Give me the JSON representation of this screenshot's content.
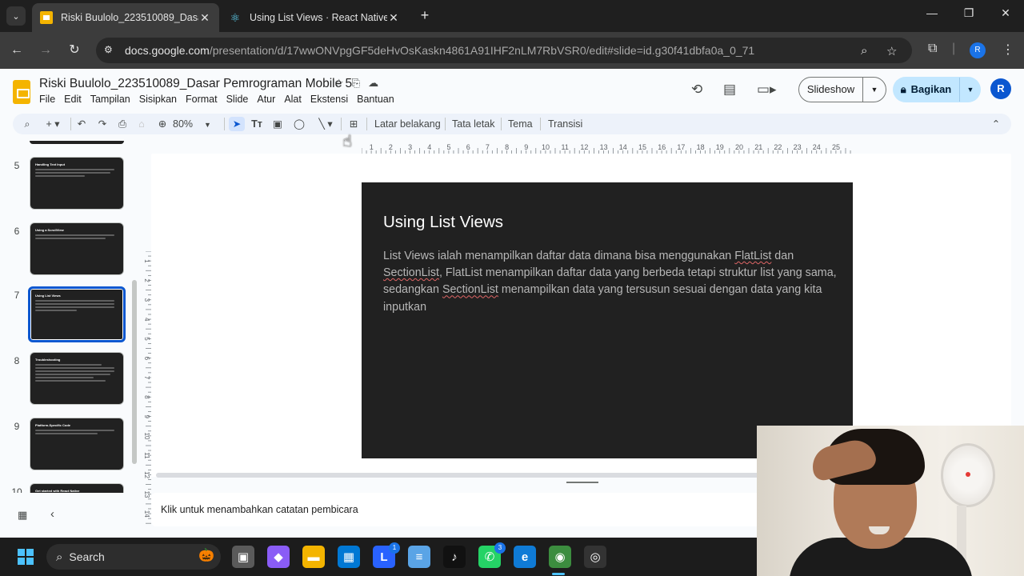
{
  "browser": {
    "tabs": [
      {
        "title": "Riski Buulolo_223510089_Dasar Pemrograman Mobile 5",
        "active": true
      },
      {
        "title": "Using List Views · React Native",
        "active": false
      }
    ],
    "url_host": "docs.google.com",
    "url_path": "/presentation/d/17wwONVpgGF5deHvOsKaskn4861A91IHF2nLM7RbVSR0/edit#slide=id.g30f41dbfa0a_0_71",
    "profile_initial": "R"
  },
  "app": {
    "doc_title": "Riski Buulolo_223510089_Dasar Pemrograman Mobile 5",
    "menu": [
      "File",
      "Edit",
      "Tampilan",
      "Sisipkan",
      "Format",
      "Slide",
      "Atur",
      "Alat",
      "Ekstensi",
      "Bantuan"
    ],
    "slideshow_label": "Slideshow",
    "share_label": "Bagikan",
    "account_initial": "R",
    "toolbar": {
      "zoom": "80%",
      "background_label": "Latar belakang",
      "layout_label": "Tata letak",
      "theme_label": "Tema",
      "transition_label": "Transisi"
    },
    "filmstrip": [
      {
        "num": "5",
        "title": "Handling Text Input",
        "selected": false
      },
      {
        "num": "6",
        "title": "Using a ScrollView",
        "selected": false
      },
      {
        "num": "7",
        "title": "Using List Views",
        "selected": true
      },
      {
        "num": "8",
        "title": "Troubleshooting",
        "selected": false
      },
      {
        "num": "9",
        "title": "Platform-Specific Code",
        "selected": false
      },
      {
        "num": "10",
        "title": "Get started with React Native",
        "selected": false
      }
    ],
    "ruler_h": [
      "1",
      "2",
      "3",
      "4",
      "5",
      "6",
      "7",
      "8",
      "9",
      "10",
      "11",
      "12",
      "13",
      "14",
      "15",
      "16",
      "17",
      "18",
      "19",
      "20",
      "21",
      "22",
      "23",
      "24",
      "25"
    ],
    "ruler_v": [
      "1",
      "2",
      "3",
      "4",
      "5",
      "6",
      "7",
      "8",
      "9",
      "10",
      "11",
      "12",
      "13",
      "14"
    ],
    "slide": {
      "title": "Using List Views",
      "body_parts": [
        {
          "text": "List Views ialah menampilkan daftar data dimana bisa menggunakan ",
          "spell": false
        },
        {
          "text": "FlatList",
          "spell": true
        },
        {
          "text": " dan ",
          "spell": false
        },
        {
          "text": "SectionList",
          "spell": true
        },
        {
          "text": ", FlatList menampilkan daftar data yang berbeda tetapi struktur list yang sama, sedangkan ",
          "spell": false
        },
        {
          "text": "SectionList",
          "spell": true
        },
        {
          "text": " menampilkan data yang tersusun sesuai dengan data yang kita inputkan",
          "spell": false
        }
      ]
    },
    "notes_placeholder": "Klik untuk menambahkan catatan pembicara"
  },
  "taskbar": {
    "search_label": "Search",
    "apps": [
      {
        "name": "file-manager",
        "glyph": "▣",
        "color": "#5a5a5a",
        "badge": ""
      },
      {
        "name": "copilot",
        "glyph": "◆",
        "color": "#8a5cf6",
        "badge": ""
      },
      {
        "name": "file-explorer",
        "glyph": "▬",
        "color": "#f4b400",
        "badge": ""
      },
      {
        "name": "microsoft-store",
        "glyph": "▦",
        "color": "#0078d4",
        "badge": ""
      },
      {
        "name": "lark",
        "glyph": "L",
        "color": "#2962ff",
        "badge": "1"
      },
      {
        "name": "notepad",
        "glyph": "≡",
        "color": "#5aa4e6",
        "badge": ""
      },
      {
        "name": "tiktok",
        "glyph": "♪",
        "color": "#111111",
        "badge": ""
      },
      {
        "name": "whatsapp",
        "glyph": "✆",
        "color": "#25d366",
        "badge": "3"
      },
      {
        "name": "edge",
        "glyph": "e",
        "color": "#0f7bd6",
        "badge": ""
      },
      {
        "name": "chrome",
        "glyph": "◉",
        "color": "#3c8d3f",
        "badge": ""
      },
      {
        "name": "obs",
        "glyph": "◎",
        "color": "#333333",
        "badge": ""
      }
    ]
  }
}
